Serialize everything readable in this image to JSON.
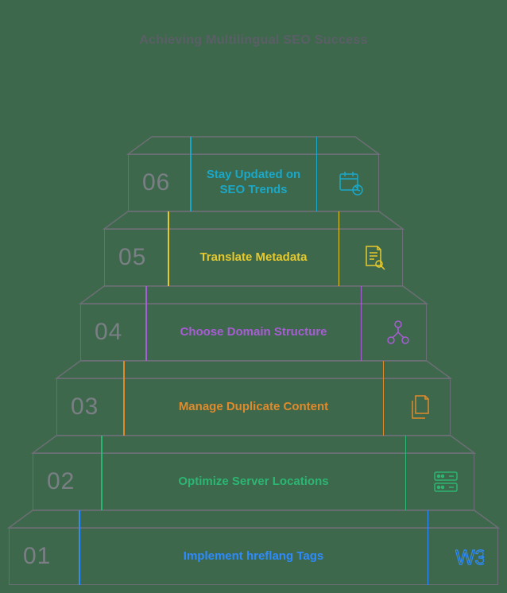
{
  "title": "Achieving Multilingual SEO Success",
  "steps": [
    {
      "num": "01",
      "label": "Implement hreflang Tags",
      "color": "#2e8bff",
      "icon": "w3-icon"
    },
    {
      "num": "02",
      "label": "Optimize Server Locations",
      "color": "#2bb673",
      "icon": "server-icon"
    },
    {
      "num": "03",
      "label": "Manage Duplicate Content",
      "color": "#e08a2c",
      "icon": "documents-icon"
    },
    {
      "num": "04",
      "label": "Choose Domain Structure",
      "color": "#a85cd6",
      "icon": "tree-icon"
    },
    {
      "num": "05",
      "label": "Translate Metadata",
      "color": "#e6c92c",
      "icon": "doc-search-icon"
    },
    {
      "num": "06",
      "label": "Stay Updated on SEO Trends",
      "color": "#1aa8c9",
      "icon": "calendar-refresh-icon"
    }
  ]
}
